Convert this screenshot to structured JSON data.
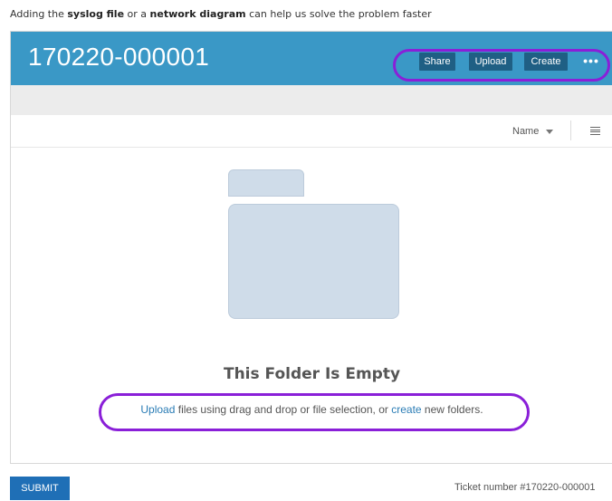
{
  "hint": {
    "prefix": "Adding the ",
    "syslog": "syslog file",
    "middle": " or a ",
    "network": "network diagram",
    "suffix": " can help us solve the problem faster"
  },
  "header": {
    "title": "170220-000001",
    "share_label": "Share",
    "upload_label": "Upload",
    "create_label": "Create",
    "more_label": "•••"
  },
  "sortbar": {
    "sort_label": "Name",
    "view_icon": "list-view-icon"
  },
  "empty": {
    "title": "This Folder Is Empty",
    "upload_link": "Upload",
    "msg_middle": " files using drag and drop or file selection, or ",
    "create_link": "create",
    "msg_end": " new folders."
  },
  "footer": {
    "submit_label": "SUBMIT",
    "ticket_number": "Ticket number #170220-000001"
  },
  "colors": {
    "header_bg": "#3a98c6",
    "button_bg": "#1f5f84",
    "highlight_ring": "#8a1fd8",
    "submit_bg": "#1f6fb6",
    "link": "#2a7cb5"
  }
}
